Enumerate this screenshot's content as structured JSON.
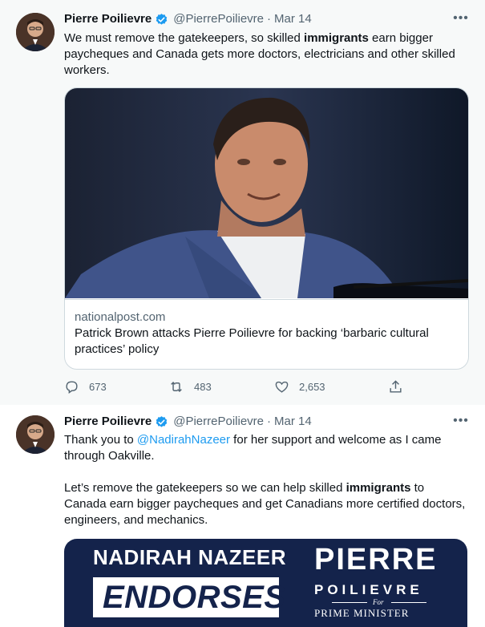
{
  "colors": {
    "link": "#1d9bf0",
    "verified": "#1d9bf0",
    "muted": "#536471",
    "text": "#0f1419"
  },
  "tweets": [
    {
      "author": {
        "name": "Pierre Poilievre",
        "handle": "@PierrePoilievre",
        "verified": true
      },
      "separator": "·",
      "date": "Mar 14",
      "more_icon": "more-horizontal-icon",
      "text": {
        "before": "We must remove the gatekeepers, so skilled ",
        "bold": "immigrants",
        "after": " earn bigger paycheques and Canada gets more doctors, electricians and other skilled workers."
      },
      "card": {
        "domain": "nationalpost.com",
        "title": "Patrick Brown attacks Pierre Poilievre for backing ‘barbaric cultural practices’ policy"
      },
      "actions": {
        "replies": "673",
        "retweets": "483",
        "likes": "2,653"
      }
    },
    {
      "author": {
        "name": "Pierre Poilievre",
        "handle": "@PierrePoilievre",
        "verified": true
      },
      "separator": "·",
      "date": "Mar 14",
      "more_icon": "more-horizontal-icon",
      "text": {
        "line1_before": "Thank you to ",
        "mention": "@NadirahNazeer",
        "line1_after": " for her support and welcome as I came through Oakville.",
        "para2_before": "Let’s remove the gatekeepers so we can help skilled ",
        "bold": "immigrants",
        "para2_after": " to Canada earn bigger paycheques and get Canadians more certified doctors, engineers, and mechanics."
      },
      "card": {
        "line1": "NADIRAH NAZEER",
        "line2": "ENDORSES",
        "line3": "PIERRE",
        "line4": "POILIEVRE",
        "line5": "For",
        "line6": "PRIME MINISTER"
      }
    }
  ]
}
